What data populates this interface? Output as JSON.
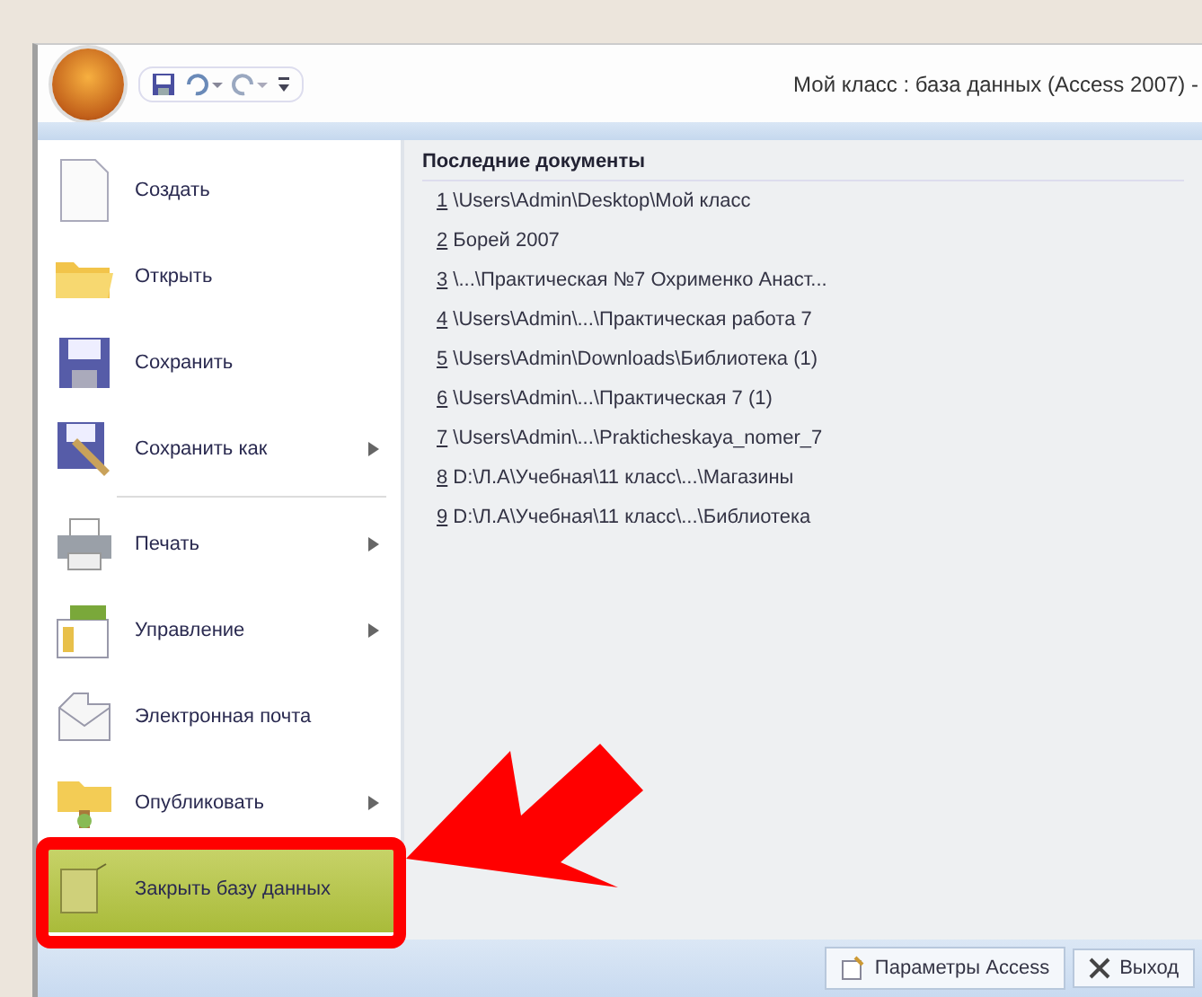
{
  "window": {
    "title": "Мой класс : база данных (Access 2007) -"
  },
  "menu": {
    "items": [
      {
        "label": "Создать",
        "submenu": false,
        "selected": false
      },
      {
        "label": "Открыть",
        "submenu": false,
        "selected": false
      },
      {
        "label": "Сохранить",
        "submenu": false,
        "selected": false
      },
      {
        "label": "Сохранить как",
        "submenu": true,
        "selected": false
      },
      {
        "label": "Печать",
        "submenu": true,
        "selected": false
      },
      {
        "label": "Управление",
        "submenu": true,
        "selected": false
      },
      {
        "label": "Электронная почта",
        "submenu": false,
        "selected": false
      },
      {
        "label": "Опубликовать",
        "submenu": true,
        "selected": false
      },
      {
        "label": "Закрыть базу данных",
        "submenu": false,
        "selected": true
      }
    ]
  },
  "recent": {
    "title": "Последние документы",
    "items": [
      {
        "number": "1",
        "path": "\\Users\\Admin\\Desktop\\Мой класс"
      },
      {
        "number": "2",
        "path": "Борей 2007"
      },
      {
        "number": "3",
        "path": "\\...\\Практическая №7 Охрименко Анаст..."
      },
      {
        "number": "4",
        "path": "\\Users\\Admin\\...\\Практическая работа 7"
      },
      {
        "number": "5",
        "path": "\\Users\\Admin\\Downloads\\Библиотека (1)"
      },
      {
        "number": "6",
        "path": "\\Users\\Admin\\...\\Практическая 7 (1)"
      },
      {
        "number": "7",
        "path": "\\Users\\Admin\\...\\Prakticheskaya_nomer_7"
      },
      {
        "number": "8",
        "path": "D:\\Л.А\\Учебная\\11 класс\\...\\Магазины"
      },
      {
        "number": "9",
        "path": "D:\\Л.А\\Учебная\\11 класс\\...\\Библиотека"
      }
    ]
  },
  "footer": {
    "buttons": [
      {
        "label": "Параметры Access"
      },
      {
        "label": "Выход"
      }
    ]
  }
}
